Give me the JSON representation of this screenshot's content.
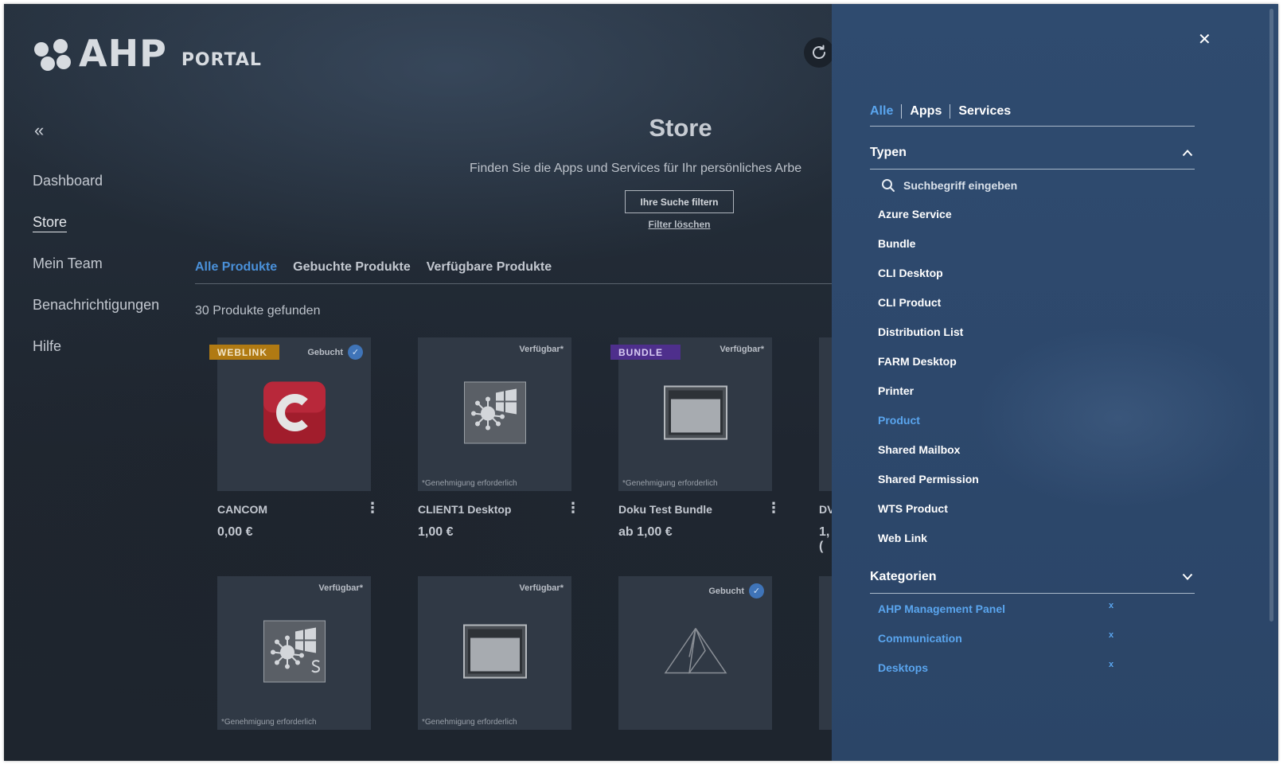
{
  "brand": {
    "logo_text": "AHP",
    "logo_sub": "PORTAL"
  },
  "sidebar": {
    "collapse_icon": "double-chevron-left-icon",
    "items": [
      {
        "label": "Dashboard"
      },
      {
        "label": "Store",
        "active": true
      },
      {
        "label": "Mein Team"
      },
      {
        "label": "Benachrichtigungen"
      },
      {
        "label": "Hilfe"
      }
    ]
  },
  "main": {
    "title": "Store",
    "subtitle": "Finden Sie die Apps und Services für Ihr persönliches Arbe",
    "filter_button": "Ihre Suche filtern",
    "filter_clear": "Filter löschen",
    "tabs": [
      {
        "label": "Alle Produkte",
        "active": true
      },
      {
        "label": "Gebuchte Produkte"
      },
      {
        "label": "Verfügbare Produkte"
      }
    ],
    "result_count": "30 Produkte gefunden",
    "products": [
      {
        "badge": "WEBLINK",
        "status": "Gebucht",
        "booked": true,
        "note": "",
        "name": "CANCOM",
        "price": "0,00 €",
        "icon": "cancom-logo-icon"
      },
      {
        "badge": "",
        "status": "Verfügbar*",
        "booked": false,
        "note": "*Genehmigung erforderlich",
        "name": "CLIENT1 Desktop",
        "price": "1,00 €",
        "icon": "windows-network-icon"
      },
      {
        "badge": "BUNDLE",
        "status": "Verfügbar*",
        "booked": false,
        "note": "*Genehmigung erforderlich",
        "name": "Doku Test Bundle",
        "price": "ab 1,00 €",
        "icon": "window-frame-icon"
      },
      {
        "badge": "",
        "status": "Verfügbar*",
        "booked": false,
        "note": "*Genehmigung erforderlich",
        "name": "",
        "price": "",
        "icon": "windows-network-s-icon"
      },
      {
        "badge": "",
        "status": "Verfügbar*",
        "booked": false,
        "note": "*Genehmigung erforderlich",
        "name": "",
        "price": "",
        "icon": "window-frame-icon"
      },
      {
        "badge": "",
        "status": "Gebucht",
        "booked": true,
        "note": "",
        "name": "",
        "price": "",
        "icon": "azure-logo-icon"
      }
    ],
    "partial_card": {
      "name_fragment": "DV",
      "price_fragment": "1,("
    }
  },
  "panel": {
    "close_icon": "close-icon",
    "tabs": [
      {
        "label": "Alle",
        "active": true
      },
      {
        "label": "Apps"
      },
      {
        "label": "Services"
      }
    ],
    "types": {
      "title": "Typen",
      "expanded": true,
      "search_placeholder": "Suchbegriff eingeben",
      "items": [
        {
          "label": "Azure Service"
        },
        {
          "label": "Bundle"
        },
        {
          "label": "CLI Desktop"
        },
        {
          "label": "CLI Product"
        },
        {
          "label": "Distribution List"
        },
        {
          "label": "FARM Desktop"
        },
        {
          "label": "Printer"
        },
        {
          "label": "Product",
          "active": true
        },
        {
          "label": "Shared Mailbox"
        },
        {
          "label": "Shared Permission"
        },
        {
          "label": "WTS Product"
        },
        {
          "label": "Web Link"
        }
      ]
    },
    "categories": {
      "title": "Kategorien",
      "expanded": false,
      "remove_label": "x",
      "items": [
        {
          "label": "AHP Management Panel"
        },
        {
          "label": "Communication"
        },
        {
          "label": "Desktops"
        }
      ]
    }
  },
  "colors": {
    "accent": "#4a90d9",
    "panel_bg": "#2d486c",
    "weblink": "#b07a13",
    "bundle": "#4e2f8c"
  }
}
